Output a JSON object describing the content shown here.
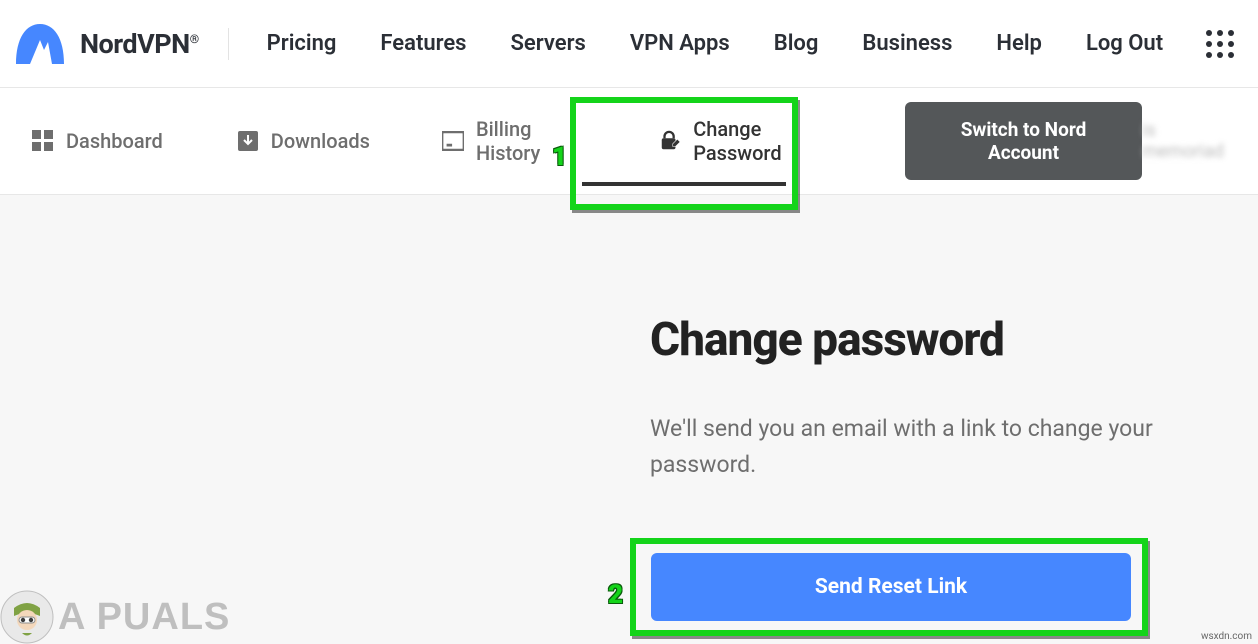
{
  "brand": "NordVPN",
  "topnav": {
    "pricing": "Pricing",
    "features": "Features",
    "servers": "Servers",
    "vpnapps": "VPN Apps",
    "blog": "Blog",
    "business": "Business",
    "help": "Help",
    "logout": "Log Out"
  },
  "subnav": {
    "dashboard": "Dashboard",
    "downloads": "Downloads",
    "billing": "Billing History",
    "changepw": "Change Password",
    "switch": "Switch to Nord Account"
  },
  "annotations": {
    "one": "1",
    "two": "2"
  },
  "main": {
    "title": "Change password",
    "desc": "We'll send you an email with a link to change your password.",
    "button": "Send Reset Link"
  },
  "watermark": {
    "brand": "A  PUALS",
    "source": "wsxdn.com"
  }
}
